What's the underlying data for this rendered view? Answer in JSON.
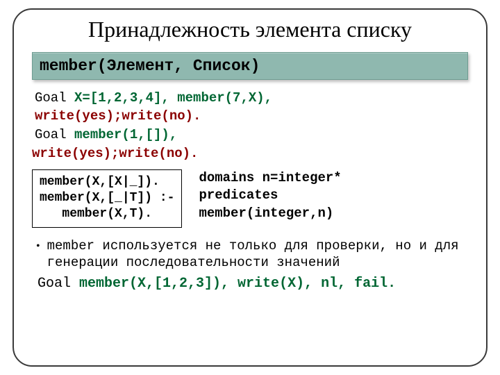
{
  "title": "Принадлежность элемента списку",
  "banner": "member(Элемент, Список)",
  "example1": {
    "prefix": "Goal ",
    "green": "X=[1,2,3,4], member(7,X),",
    "cont": "write(yes);write(no)."
  },
  "example2": {
    "prefix": "Goal  ",
    "green": "member(1,[]),",
    "cont": "write(yes);write(no)."
  },
  "code_box": "member(X,[X|_]).\nmember(X,[_|T]) :-\n   member(X,T).",
  "domains": {
    "l1": "domains n=integer*",
    "l2": "predicates",
    "l3": "member(integer,n)"
  },
  "bullet": "member используется не только для проверки, но и для генерации последовательности значений",
  "goal_last": {
    "prefix": "Goal ",
    "green": "member(X,[1,2,3]), write(X), nl, fail."
  }
}
